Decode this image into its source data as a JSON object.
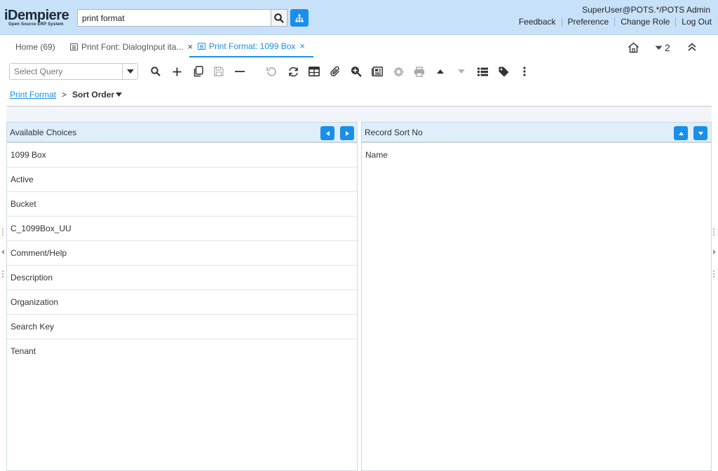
{
  "header": {
    "logo_main": "iDempiere",
    "logo_sub": "Open Source ERP System",
    "search_value": "print format",
    "user": "SuperUser@POTS.*/POTS Admin",
    "links": [
      "Feedback",
      "Preference",
      "Change Role",
      "Log Out"
    ]
  },
  "tabs": {
    "home": "Home (69)",
    "tab1": "Print Font: DialogInput ita...",
    "tab2": "Print Format: 1099 Box",
    "window_count": "2"
  },
  "toolbar": {
    "query_placeholder": "Select Query"
  },
  "breadcrumb": {
    "parent": "Print Format",
    "separator": ">",
    "current": "Sort Order"
  },
  "left_panel": {
    "title": "Available Choices",
    "items": [
      "1099 Box",
      "Active",
      "Bucket",
      "C_1099Box_UU",
      "Comment/Help",
      "Description",
      "Organization",
      "Search Key",
      "Tenant"
    ]
  },
  "right_panel": {
    "title": "Record Sort No",
    "items": [
      "Name"
    ]
  },
  "colors": {
    "header_bg": "#c7e2f8",
    "accent": "#1a8fe8",
    "panel_head_bg": "#deeefb"
  }
}
